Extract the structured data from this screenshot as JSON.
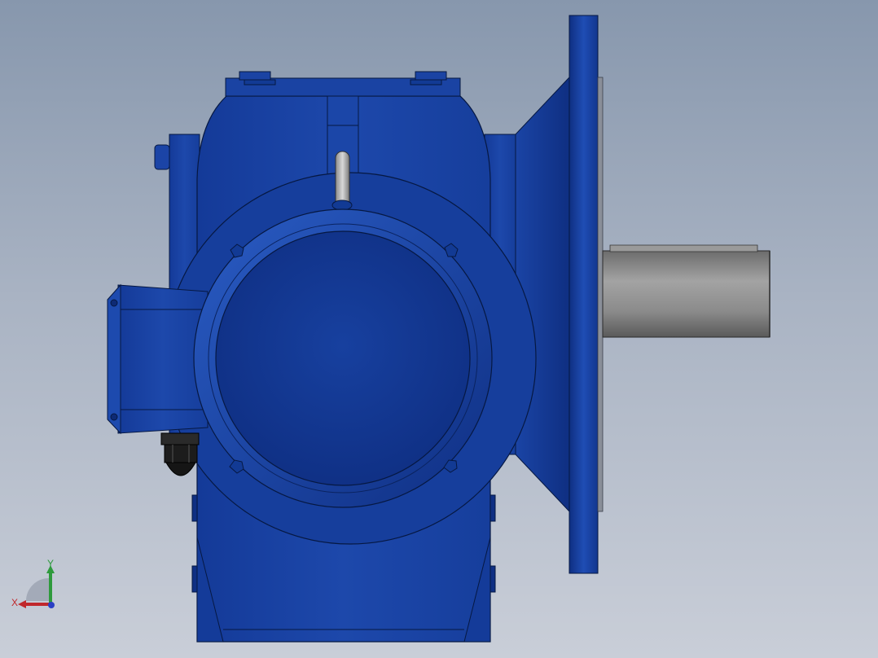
{
  "colors": {
    "background_top": "#8797ad",
    "background_bottom": "#c9ced8",
    "housing_blue": "#1a43a3",
    "housing_dark": "#0e2a74",
    "shaft_gray": "#8a8a8a",
    "cable_gland": "#1c1c1c",
    "axis_x": "#c0282c",
    "axis_y": "#2e9a3c",
    "axis_z": "#2a3fc4"
  },
  "triad": {
    "x_label": "X",
    "y_label": "Y"
  }
}
